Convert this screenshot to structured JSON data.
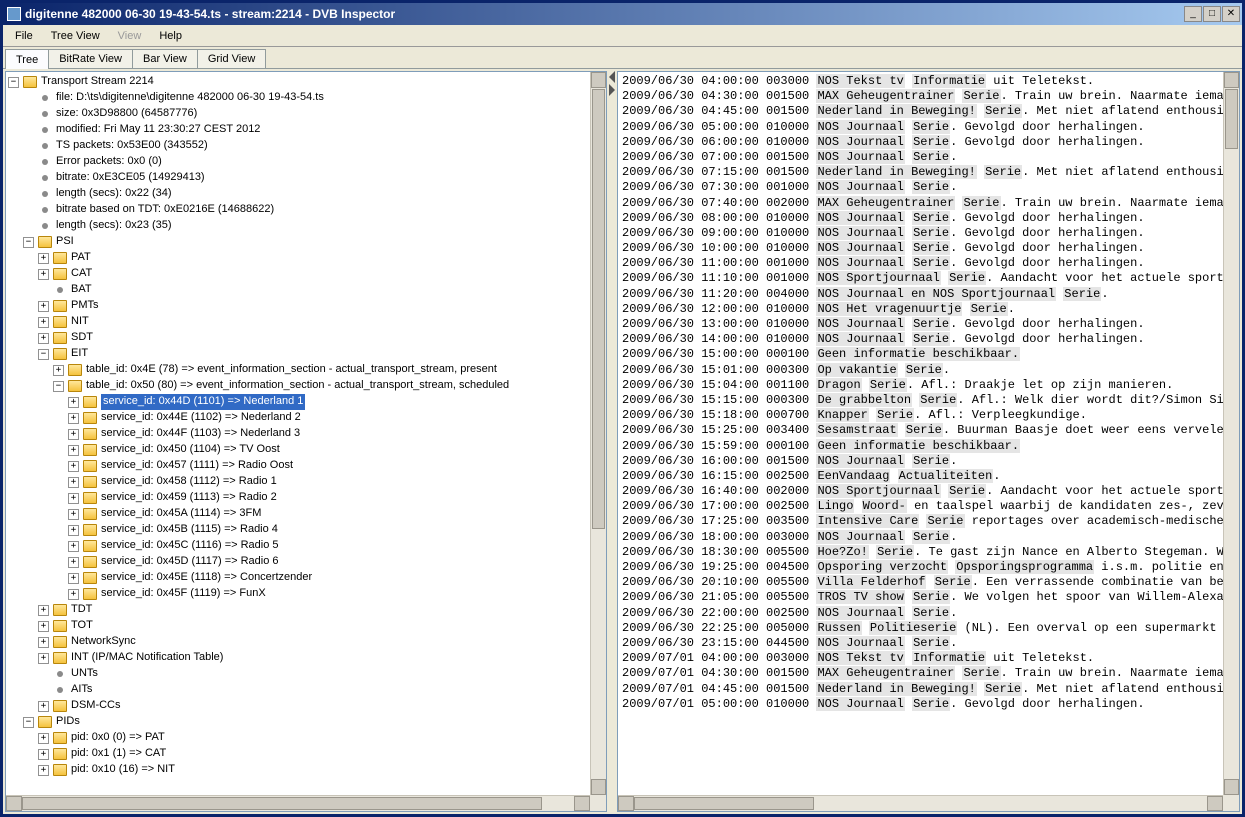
{
  "window": {
    "title": "digitenne 482000 06-30 19-43-54.ts - stream:2214 - DVB Inspector"
  },
  "menu": {
    "file": "File",
    "treeview": "Tree View",
    "view": "View",
    "help": "Help"
  },
  "tabs": [
    "Tree",
    "BitRate View",
    "Bar View",
    "Grid View"
  ],
  "tree": {
    "root": "Transport Stream 2214",
    "meta": [
      "file: D:\\ts\\digitenne\\digitenne 482000 06-30 19-43-54.ts",
      "size: 0x3D98800 (64587776)",
      "modified: Fri May 11 23:30:27 CEST 2012",
      "TS packets: 0x53E00 (343552)",
      "Error packets: 0x0 (0)",
      "bitrate: 0xE3CE05 (14929413)",
      "length (secs): 0x22 (34)",
      "bitrate based on TDT: 0xE0216E (14688622)",
      "length (secs): 0x23 (35)"
    ],
    "psi_label": "PSI",
    "psi_children": [
      "PAT",
      "CAT",
      "BAT",
      "PMTs",
      "NIT",
      "SDT"
    ],
    "eit_label": "EIT",
    "eit_table_4e": "table_id: 0x4E (78) => event_information_section - actual_transport_stream, present",
    "eit_table_50": "table_id: 0x50 (80) => event_information_section - actual_transport_stream, scheduled",
    "services": [
      {
        "sel": true,
        "text": "service_id: 0x44D (1101) => Nederland 1"
      },
      {
        "sel": false,
        "text": "service_id: 0x44E (1102) => Nederland 2"
      },
      {
        "sel": false,
        "text": "service_id: 0x44F (1103) => Nederland 3"
      },
      {
        "sel": false,
        "text": "service_id: 0x450 (1104) => TV Oost"
      },
      {
        "sel": false,
        "text": "service_id: 0x457 (1111) => Radio Oost"
      },
      {
        "sel": false,
        "text": "service_id: 0x458 (1112) => Radio 1"
      },
      {
        "sel": false,
        "text": "service_id: 0x459 (1113) => Radio 2"
      },
      {
        "sel": false,
        "text": "service_id: 0x45A (1114) => 3FM"
      },
      {
        "sel": false,
        "text": "service_id: 0x45B (1115) => Radio 4"
      },
      {
        "sel": false,
        "text": "service_id: 0x45C (1116) => Radio 5"
      },
      {
        "sel": false,
        "text": "service_id: 0x45D (1117) => Radio 6"
      },
      {
        "sel": false,
        "text": "service_id: 0x45E (1118) => Concertzender"
      },
      {
        "sel": false,
        "text": "service_id: 0x45F (1119) => FunX"
      }
    ],
    "psi_tail": [
      "TDT",
      "TOT",
      "NetworkSync",
      "INT (IP/MAC Notification Table)",
      "UNTs",
      "AITs",
      "DSM-CCs"
    ],
    "pids_label": "PIDs",
    "pids": [
      "pid: 0x0 (0) => PAT",
      "pid: 0x1 (1) => CAT",
      "pid: 0x10 (16) => NIT"
    ]
  },
  "events": [
    {
      "date": "2009/06/30",
      "time": "04:00:00",
      "dur": "003000",
      "title": "NOS Tekst tv",
      "desc": "Informatie uit Teletekst."
    },
    {
      "date": "2009/06/30",
      "time": "04:30:00",
      "dur": "001500",
      "title": "MAX Geheugentrainer",
      "desc": "Serie. Train uw brein. Naarmate ieman"
    },
    {
      "date": "2009/06/30",
      "time": "04:45:00",
      "dur": "001500",
      "title": "Nederland in Beweging!",
      "desc": "Serie. Met niet aflatend enthousia"
    },
    {
      "date": "2009/06/30",
      "time": "05:00:00",
      "dur": "010000",
      "title": "NOS Journaal",
      "desc": "Serie. Gevolgd door herhalingen."
    },
    {
      "date": "2009/06/30",
      "time": "06:00:00",
      "dur": "010000",
      "title": "NOS Journaal",
      "desc": "Serie. Gevolgd door herhalingen."
    },
    {
      "date": "2009/06/30",
      "time": "07:00:00",
      "dur": "001500",
      "title": "NOS Journaal",
      "desc": "Serie."
    },
    {
      "date": "2009/06/30",
      "time": "07:15:00",
      "dur": "001500",
      "title": "Nederland in Beweging!",
      "desc": "Serie. Met niet aflatend enthousia"
    },
    {
      "date": "2009/06/30",
      "time": "07:30:00",
      "dur": "001000",
      "title": "NOS Journaal",
      "desc": "Serie."
    },
    {
      "date": "2009/06/30",
      "time": "07:40:00",
      "dur": "002000",
      "title": "MAX Geheugentrainer",
      "desc": "Serie. Train uw brein. Naarmate ieman"
    },
    {
      "date": "2009/06/30",
      "time": "08:00:00",
      "dur": "010000",
      "title": "NOS Journaal",
      "desc": "Serie. Gevolgd door herhalingen."
    },
    {
      "date": "2009/06/30",
      "time": "09:00:00",
      "dur": "010000",
      "title": "NOS Journaal",
      "desc": "Serie. Gevolgd door herhalingen."
    },
    {
      "date": "2009/06/30",
      "time": "10:00:00",
      "dur": "010000",
      "title": "NOS Journaal",
      "desc": "Serie. Gevolgd door herhalingen."
    },
    {
      "date": "2009/06/30",
      "time": "11:00:00",
      "dur": "001000",
      "title": "NOS Journaal",
      "desc": "Serie. Gevolgd door herhalingen."
    },
    {
      "date": "2009/06/30",
      "time": "11:10:00",
      "dur": "001000",
      "title": "NOS Sportjournaal",
      "desc": "Serie. Aandacht voor het actuele sportn"
    },
    {
      "date": "2009/06/30",
      "time": "11:20:00",
      "dur": "004000",
      "title": "NOS Journaal en NOS Sportjournaal",
      "desc": "Serie."
    },
    {
      "date": "2009/06/30",
      "time": "12:00:00",
      "dur": "010000",
      "title": "NOS Het vragenuurtje",
      "desc": "Serie."
    },
    {
      "date": "2009/06/30",
      "time": "13:00:00",
      "dur": "010000",
      "title": "NOS Journaal",
      "desc": "Serie. Gevolgd door herhalingen."
    },
    {
      "date": "2009/06/30",
      "time": "14:00:00",
      "dur": "010000",
      "title": "NOS Journaal",
      "desc": "Serie. Gevolgd door herhalingen."
    },
    {
      "date": "2009/06/30",
      "time": "15:00:00",
      "dur": "000100",
      "title": "Geen informatie beschikbaar.",
      "desc": ""
    },
    {
      "date": "2009/06/30",
      "time": "15:01:00",
      "dur": "000300",
      "title": "Op vakantie",
      "desc": "Serie."
    },
    {
      "date": "2009/06/30",
      "time": "15:04:00",
      "dur": "001100",
      "title": "Dragon",
      "desc": "Serie. Afl.: Draakje let op zijn manieren."
    },
    {
      "date": "2009/06/30",
      "time": "15:15:00",
      "dur": "000300",
      "title": "De grabbelton",
      "desc": "Serie. Afl.: Welk dier wordt dit?/Simon Sim"
    },
    {
      "date": "2009/06/30",
      "time": "15:18:00",
      "dur": "000700",
      "title": "Knapper",
      "desc": "Serie. Afl.: Verpleegkundige."
    },
    {
      "date": "2009/06/30",
      "time": "15:25:00",
      "dur": "003400",
      "title": "Sesamstraat",
      "desc": "Serie. Buurman Baasje doet weer eens vervelen"
    },
    {
      "date": "2009/06/30",
      "time": "15:59:00",
      "dur": "000100",
      "title": "Geen informatie beschikbaar.",
      "desc": ""
    },
    {
      "date": "2009/06/30",
      "time": "16:00:00",
      "dur": "001500",
      "title": "NOS Journaal",
      "desc": "Serie."
    },
    {
      "date": "2009/06/30",
      "time": "16:15:00",
      "dur": "002500",
      "title": "EenVandaag",
      "desc": "Actualiteiten."
    },
    {
      "date": "2009/06/30",
      "time": "16:40:00",
      "dur": "002000",
      "title": "NOS Sportjournaal",
      "desc": "Serie. Aandacht voor het actuele sportn"
    },
    {
      "date": "2009/06/30",
      "time": "17:00:00",
      "dur": "002500",
      "title": "Lingo",
      "desc": "Woord- en taalspel waarbij de kandidaten zes-, zeve"
    },
    {
      "date": "2009/06/30",
      "time": "17:25:00",
      "dur": "003500",
      "title": "Intensive Care",
      "desc": "Serie reportages over academisch-medische"
    },
    {
      "date": "2009/06/30",
      "time": "18:00:00",
      "dur": "003000",
      "title": "NOS Journaal",
      "desc": "Serie."
    },
    {
      "date": "2009/06/30",
      "time": "18:30:00",
      "dur": "005500",
      "title": "Hoe?Zo!",
      "desc": "Serie. Te gast zijn Nance en Alberto Stegeman. We"
    },
    {
      "date": "2009/06/30",
      "time": "19:25:00",
      "dur": "004500",
      "title": "Opsporing verzocht",
      "desc": "Opsporingsprogramma i.s.m. politie en"
    },
    {
      "date": "2009/06/30",
      "time": "20:10:00",
      "dur": "005500",
      "title": "Villa Felderhof",
      "desc": "Serie. Een verrassende combinatie van bek"
    },
    {
      "date": "2009/06/30",
      "time": "21:05:00",
      "dur": "005500",
      "title": "TROS TV show",
      "desc": "Serie. We volgen het spoor van Willem-Alexan"
    },
    {
      "date": "2009/06/30",
      "time": "22:00:00",
      "dur": "002500",
      "title": "NOS Journaal",
      "desc": "Serie."
    },
    {
      "date": "2009/06/30",
      "time": "22:25:00",
      "dur": "005000",
      "title": "Russen",
      "desc": "Politieserie (NL). Een overval op een supermarkt l"
    },
    {
      "date": "2009/06/30",
      "time": "23:15:00",
      "dur": "044500",
      "title": "NOS Journaal",
      "desc": "Serie."
    },
    {
      "date": "2009/07/01",
      "time": "04:00:00",
      "dur": "003000",
      "title": "NOS Tekst tv",
      "desc": "Informatie uit Teletekst."
    },
    {
      "date": "2009/07/01",
      "time": "04:30:00",
      "dur": "001500",
      "title": "MAX Geheugentrainer",
      "desc": "Serie. Train uw brein. Naarmate ieman"
    },
    {
      "date": "2009/07/01",
      "time": "04:45:00",
      "dur": "001500",
      "title": "Nederland in Beweging!",
      "desc": "Serie. Met niet aflatend enthousia"
    },
    {
      "date": "2009/07/01",
      "time": "05:00:00",
      "dur": "010000",
      "title": "NOS Journaal",
      "desc": "Serie. Gevolgd door herhalingen."
    }
  ]
}
